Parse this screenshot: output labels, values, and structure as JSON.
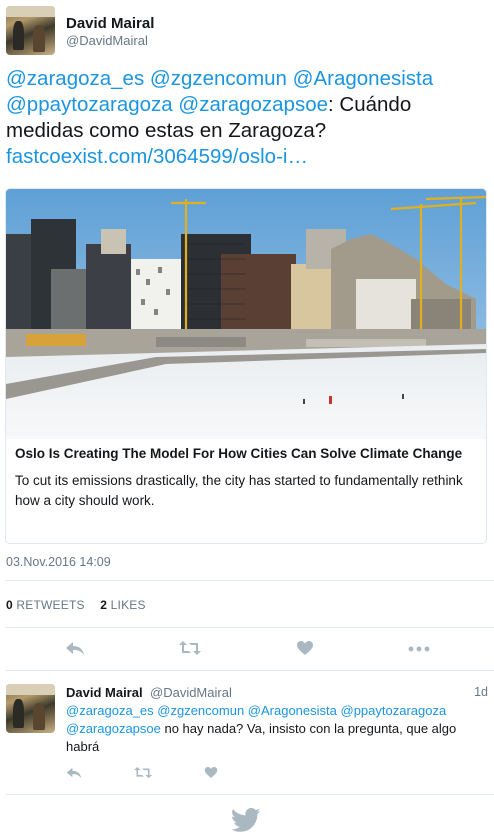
{
  "tweet": {
    "author_name": "David Mairal",
    "author_handle": "@DavidMairal",
    "text_parts": [
      {
        "text": "@zaragoza_es",
        "link": true
      },
      {
        "text": " ",
        "link": false
      },
      {
        "text": "@zgzencomun",
        "link": true
      },
      {
        "text": " ",
        "link": false
      },
      {
        "text": "@Aragonesista",
        "link": true
      },
      {
        "text": " ",
        "link": false
      },
      {
        "text": "@ppaytozaragoza",
        "link": true
      },
      {
        "text": " ",
        "link": false
      },
      {
        "text": "@zaragozapsoe",
        "link": true
      },
      {
        "text": ": Cuándo medidas como estas en Zaragoza? ",
        "link": false
      },
      {
        "text": "fastcoexist.com/3064599/oslo-i…",
        "link": true
      }
    ],
    "card": {
      "title": "Oslo Is Creating The Model For How Cities Can Solve Climate Change",
      "description": "To cut its emissions drastically, the city has started to fundamentally rethink how a city should work."
    },
    "timestamp": "03.Nov.2016 14:09",
    "stats": {
      "retweets_count": "0",
      "retweets_label": "RETWEETS",
      "likes_count": "2",
      "likes_label": "LIKES"
    }
  },
  "reply": {
    "author_name": "David Mairal",
    "author_handle": "@DavidMairal",
    "time": "1d",
    "text_parts": [
      {
        "text": "@zaragoza_es",
        "link": true
      },
      {
        "text": " ",
        "link": false
      },
      {
        "text": "@zgzencomun",
        "link": true
      },
      {
        "text": " ",
        "link": false
      },
      {
        "text": "@Aragonesista",
        "link": true
      },
      {
        "text": " ",
        "link": false
      },
      {
        "text": "@ppaytozaragoza",
        "link": true
      },
      {
        "text": " ",
        "link": false
      },
      {
        "text": "@zaragozapsoe",
        "link": true
      },
      {
        "text": " no hay nada? Va, insisto con la pregunta, que algo habrá",
        "link": false
      }
    ]
  },
  "colors": {
    "link": "#1b95e0",
    "secondary_text": "#657786",
    "icon": "#aab8c2",
    "divider": "#e1e8ed"
  },
  "icons": [
    "reply-icon",
    "retweet-icon",
    "like-icon",
    "more-icon",
    "twitter-bird-icon"
  ]
}
